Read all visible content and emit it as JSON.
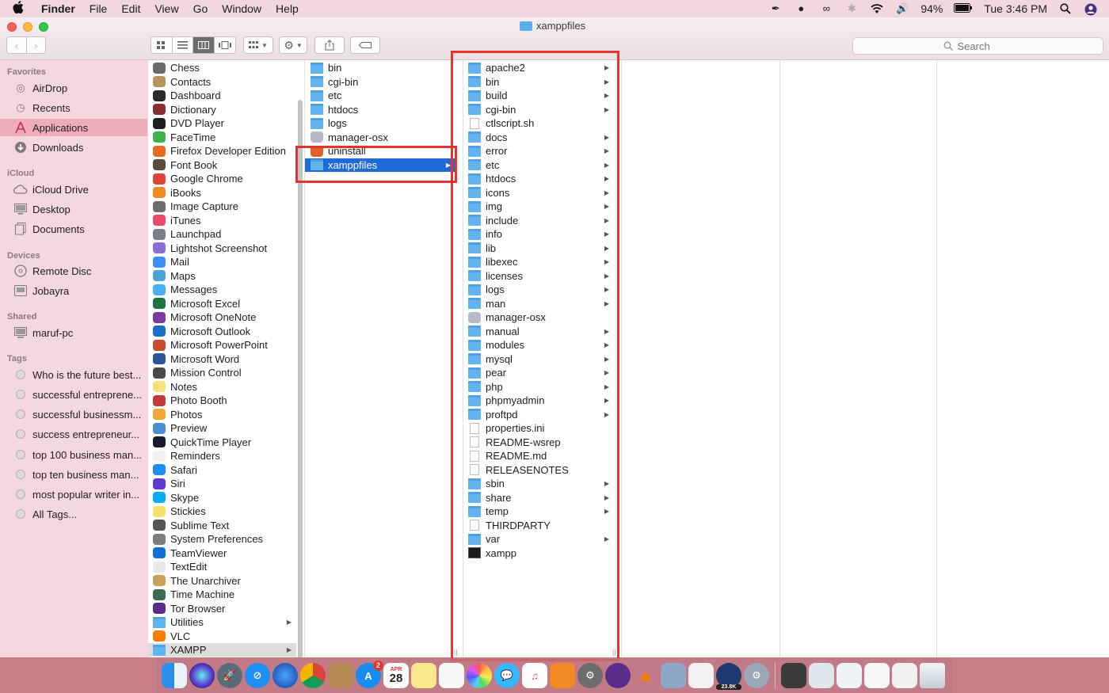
{
  "menubar": {
    "apple": "",
    "items": [
      "Finder",
      "File",
      "Edit",
      "View",
      "Go",
      "Window",
      "Help"
    ],
    "battery": "94%",
    "clock": "Tue 3:46 PM"
  },
  "window": {
    "title": "xamppfiles",
    "search_placeholder": "Search"
  },
  "sidebar": {
    "favorites_header": "Favorites",
    "favorites": [
      "AirDrop",
      "Recents",
      "Applications",
      "Downloads"
    ],
    "icloud_header": "iCloud",
    "icloud": [
      "iCloud Drive",
      "Desktop",
      "Documents"
    ],
    "devices_header": "Devices",
    "devices": [
      "Remote Disc",
      "Jobayra"
    ],
    "shared_header": "Shared",
    "shared": [
      "maruf-pc"
    ],
    "tags_header": "Tags",
    "tags": [
      "Who is the future best...",
      "successful entreprene...",
      "successful businessm...",
      "success entrepreneur...",
      "top 100 business man...",
      "top ten business man...",
      "most popular writer in...",
      "All Tags..."
    ]
  },
  "col1": {
    "items": [
      "Chess",
      "Contacts",
      "Dashboard",
      "Dictionary",
      "DVD Player",
      "FaceTime",
      "Firefox Developer Edition",
      "Font Book",
      "Google Chrome",
      "iBooks",
      "Image Capture",
      "iTunes",
      "Launchpad",
      "Lightshot Screenshot",
      "Mail",
      "Maps",
      "Messages",
      "Microsoft Excel",
      "Microsoft OneNote",
      "Microsoft Outlook",
      "Microsoft PowerPoint",
      "Microsoft Word",
      "Mission Control",
      "Notes",
      "Photo Booth",
      "Photos",
      "Preview",
      "QuickTime Player",
      "Reminders",
      "Safari",
      "Siri",
      "Skype",
      "Stickies",
      "Sublime Text",
      "System Preferences",
      "TeamViewer",
      "TextEdit",
      "The Unarchiver",
      "Time Machine",
      "Tor Browser",
      "Utilities",
      "VLC",
      "XAMPP"
    ]
  },
  "col2": {
    "items": [
      "bin",
      "cgi-bin",
      "etc",
      "htdocs",
      "logs",
      "manager-osx",
      "uninstall",
      "xamppfiles"
    ]
  },
  "col3": {
    "items": [
      "apache2",
      "bin",
      "build",
      "cgi-bin",
      "ctlscript.sh",
      "docs",
      "error",
      "etc",
      "htdocs",
      "icons",
      "img",
      "include",
      "info",
      "lib",
      "libexec",
      "licenses",
      "logs",
      "man",
      "manager-osx",
      "manual",
      "modules",
      "mysql",
      "pear",
      "php",
      "phpmyadmin",
      "proftpd",
      "properties.ini",
      "README-wsrep",
      "README.md",
      "RELEASENOTES",
      "sbin",
      "share",
      "temp",
      "THIRDPARTY",
      "var",
      "xampp"
    ]
  },
  "dock": {
    "calendar_month": "APR",
    "calendar_day": "28",
    "appstore_badge": "2",
    "speed_badge": "23.8K"
  }
}
